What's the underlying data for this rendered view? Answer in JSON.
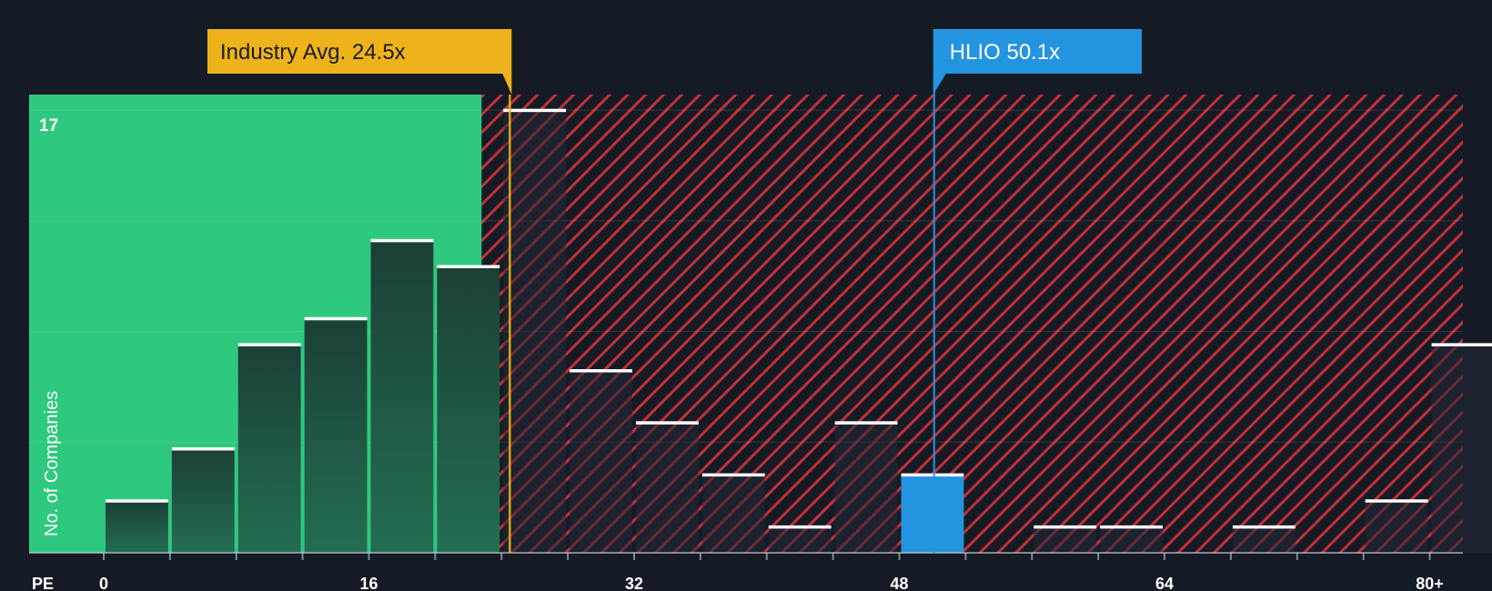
{
  "chart_data": {
    "type": "bar",
    "x_axis_label": "PE",
    "y_axis_label": "No. of Companies",
    "xlim": [
      -4.5,
      82
    ],
    "ylim": [
      0,
      17.6
    ],
    "x_ticks": [
      {
        "value": 0,
        "label": "0"
      },
      {
        "value": 16,
        "label": "16"
      },
      {
        "value": 32,
        "label": "32"
      },
      {
        "value": 48,
        "label": "48"
      },
      {
        "value": 64,
        "label": "64"
      },
      {
        "value": 80,
        "label": "80+"
      }
    ],
    "y_max_label": "17",
    "y_gridlines": [
      4.25,
      8.5,
      12.75,
      17
    ],
    "bin_width": 4,
    "bins": [
      {
        "x0": 0,
        "value": 2
      },
      {
        "x0": 4,
        "value": 4
      },
      {
        "x0": 8,
        "value": 8
      },
      {
        "x0": 12,
        "value": 9
      },
      {
        "x0": 16,
        "value": 12
      },
      {
        "x0": 20,
        "value": 11
      },
      {
        "x0": 24,
        "value": 17
      },
      {
        "x0": 28,
        "value": 7
      },
      {
        "x0": 32,
        "value": 5
      },
      {
        "x0": 36,
        "value": 3
      },
      {
        "x0": 40,
        "value": 1
      },
      {
        "x0": 44,
        "value": 5
      },
      {
        "x0": 48,
        "value": 3,
        "highlight": true
      },
      {
        "x0": 52,
        "value": 0
      },
      {
        "x0": 56,
        "value": 1
      },
      {
        "x0": 60,
        "value": 1
      },
      {
        "x0": 64,
        "value": 0
      },
      {
        "x0": 68,
        "value": 1
      },
      {
        "x0": 72,
        "value": 0
      },
      {
        "x0": 76,
        "value": 2
      },
      {
        "x0": 80,
        "value": 8
      }
    ],
    "industry_avg": {
      "value": 24.5,
      "label": "Industry Avg. 24.5x"
    },
    "company": {
      "value": 50.1,
      "label": "HLIO 50.1x"
    },
    "colors": {
      "background": "#151b24",
      "below_avg_fill": "#2ec97f",
      "bar_fill": "#1c4535",
      "hatch_stripe": "#e0323f",
      "hatch_bar_fill": "#202835",
      "highlight_bar": "#2394e0",
      "industry_callout": "#eeb31a",
      "company_callout": "#2394e0",
      "bar_cap": "#ffffff"
    }
  }
}
